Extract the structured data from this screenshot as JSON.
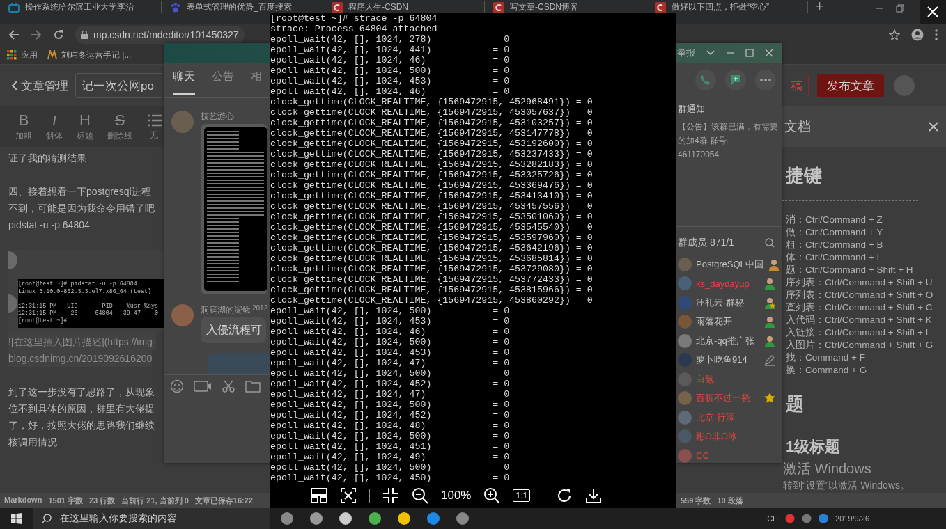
{
  "browser": {
    "tabs": [
      {
        "kind": "tv",
        "title": "操作系统哈尔滨工业大学李治"
      },
      {
        "kind": "paw",
        "title": "表单式管理的优势_百度搜索"
      },
      {
        "kind": "c-logo",
        "title": "程序人生-CSDN"
      },
      {
        "kind": "c-logo",
        "title": "写文章-CSDN博客"
      },
      {
        "kind": "c-logo",
        "title": "做好以下四点，拒做“空心”"
      }
    ],
    "new_tab": "+",
    "address": "mp.csdn.net/mdeditor/101450327",
    "bookmarks": [
      "应用",
      "刘玮冬运营手记 |..."
    ]
  },
  "editor": {
    "back_label": "文章管理",
    "title_value": "记一次公网po",
    "draft_button": "稿",
    "publish_button": "发布文章",
    "toolbar": [
      {
        "kind": "bold",
        "glyph": "B",
        "label": "加粗"
      },
      {
        "kind": "italic",
        "glyph": "I",
        "label": "斜体"
      },
      {
        "kind": "heading",
        "glyph": "H",
        "label": "标题"
      },
      {
        "kind": "strike",
        "glyph": "S",
        "label": "删除线"
      },
      {
        "kind": "list",
        "label": "无"
      }
    ],
    "content": [
      {
        "kind": "text",
        "text": "证了我的猜测结果"
      },
      {
        "kind": "blank"
      },
      {
        "kind": "text",
        "text": "四、接着想看一下postgresql进程"
      },
      {
        "kind": "text",
        "text": "不到，可能是因为我命令用错了吧"
      },
      {
        "kind": "text",
        "text": "pidstat -u -p 64804"
      },
      {
        "kind": "blank"
      },
      {
        "kind": "image",
        "lines": [
          "[root@test ~]# pidstat -u -p 64804",
          "Linux 3.10.0-862.3.3.el7.x86_64 (test)",
          "12:31:15 PM   UID       PID    %usr %sys",
          "12:31:15 PM    26     64804   39.47    0",
          "[root@test ~]#"
        ]
      },
      {
        "kind": "muted",
        "text": "![在这里插入图片描述](https://img-"
      },
      {
        "kind": "muted",
        "text": "blog.csdnimg.cn/2019092616200"
      },
      {
        "kind": "blank"
      },
      {
        "kind": "text",
        "text": "到了这一步没有了思路了，从现象"
      },
      {
        "kind": "text",
        "text": "位不到具体的原因，群里有大佬提"
      },
      {
        "kind": "text",
        "text": "了，好，按照大佬的思路我们继续"
      },
      {
        "kind": "text",
        "text": "核调用情况"
      }
    ],
    "status_left": [
      "Markdown",
      "1501 字数",
      "23 行数",
      "当前行 21, 当前列 0",
      "文章已保存16:22"
    ],
    "status_right": [
      "559 字数",
      "10 段落"
    ]
  },
  "help_panel": {
    "title": "文档",
    "heading_1": "捷键",
    "shortcuts": [
      "消：Ctrl/Command + Z",
      "做：Ctrl/Command + Y",
      "粗：Ctrl/Command + B",
      "体：Ctrl/Command + I",
      "题：Ctrl/Command + Shift + H",
      "序列表：Ctrl/Command + Shift + U",
      "序列表：Ctrl/Command + Shift + O",
      "查列表：Ctrl/Command + Shift + C",
      "入代码：Ctrl/Command + Shift + K",
      "入链接：Ctrl/Command + Shift + L",
      "入图片：Ctrl/Command + Shift + G",
      "找：Command + F",
      "换：Command + G"
    ],
    "heading_2": "题",
    "heading_3": "1级标题"
  },
  "qq": {
    "report": "举报",
    "tabs": [
      {
        "label": "聊天",
        "selected": true
      },
      {
        "label": "公告",
        "selected": false
      },
      {
        "label": "相",
        "selected": false
      }
    ],
    "messages": [
      {
        "kind": "image",
        "sender": "技艺游心"
      },
      {
        "kind": "text",
        "sender": "洞庭湖的泥鳅",
        "badge": "2012",
        "text": "入侵流程可"
      },
      {
        "kind": "cut-bubble"
      }
    ],
    "notice": {
      "title": "群通知",
      "lines": [
        "【公告】该群已满，有需要",
        "的加4群 群号:",
        "461170054"
      ]
    },
    "members_title": "群成员 871/1",
    "members": [
      {
        "name": "PostgreSQL中国",
        "color": "#c4c4c4",
        "kind": "owner"
      },
      {
        "name": "ks_daydayup",
        "color": "#e0463f",
        "kind": "admin"
      },
      {
        "name": "汪礼云-群秘",
        "color": "#c4c4c4",
        "kind": "admin-star"
      },
      {
        "name": "雨落花开",
        "color": "#c4c4c4",
        "kind": "admin"
      },
      {
        "name": "北京-qq推广张",
        "color": "#c4c4c4",
        "kind": "admin"
      },
      {
        "name": "萝卜吃鱼914",
        "color": "#c4c4c4",
        "kind": "pencil"
      },
      {
        "name": "白氪",
        "color": "#e0463f",
        "kind": "plain"
      },
      {
        "name": "百折不过一挠",
        "color": "#e0463f",
        "kind": "star"
      },
      {
        "name": "北京-行深",
        "color": "#e0463f",
        "kind": "plain"
      },
      {
        "name": "彬Θ非Θ冰",
        "color": "#e0463f",
        "kind": "plain"
      },
      {
        "name": "CC",
        "color": "#e0463f",
        "kind": "plain"
      }
    ]
  },
  "viewer": {
    "lines": [
      "[root@test ~]# strace -p 64804",
      "strace: Process 64804 attached",
      "epoll_wait(42, [], 1024, 278)           = 0",
      "epoll_wait(42, [], 1024, 441)           = 0",
      "epoll_wait(42, [], 1024, 46)            = 0",
      "epoll_wait(42, [], 1024, 500)           = 0",
      "epoll_wait(42, [], 1024, 453)           = 0",
      "epoll_wait(42, [], 1024, 46)            = 0",
      "clock_gettime(CLOCK_REALTIME, {1569472915, 452968491}) = 0",
      "clock_gettime(CLOCK_REALTIME, {1569472915, 453057637}) = 0",
      "clock_gettime(CLOCK_REALTIME, {1569472915, 453103257}) = 0",
      "clock_gettime(CLOCK_REALTIME, {1569472915, 453147778}) = 0",
      "clock_gettime(CLOCK_REALTIME, {1569472915, 453192600}) = 0",
      "clock_gettime(CLOCK_REALTIME, {1569472915, 453237433}) = 0",
      "clock_gettime(CLOCK_REALTIME, {1569472915, 453282183}) = 0",
      "clock_gettime(CLOCK_REALTIME, {1569472915, 453325726}) = 0",
      "clock_gettime(CLOCK_REALTIME, {1569472915, 453369476}) = 0",
      "clock_gettime(CLOCK_REALTIME, {1569472915, 453413410}) = 0",
      "clock_gettime(CLOCK_REALTIME, {1569472915, 453457556}) = 0",
      "clock_gettime(CLOCK_REALTIME, {1569472915, 453501060}) = 0",
      "clock_gettime(CLOCK_REALTIME, {1569472915, 453545540}) = 0",
      "clock_gettime(CLOCK_REALTIME, {1569472915, 453597960}) = 0",
      "clock_gettime(CLOCK_REALTIME, {1569472915, 453642196}) = 0",
      "clock_gettime(CLOCK_REALTIME, {1569472915, 453685814}) = 0",
      "clock_gettime(CLOCK_REALTIME, {1569472915, 453729080}) = 0",
      "clock_gettime(CLOCK_REALTIME, {1569472915, 453772433}) = 0",
      "clock_gettime(CLOCK_REALTIME, {1569472915, 453815966}) = 0",
      "clock_gettime(CLOCK_REALTIME, {1569472915, 453860292}) = 0",
      "epoll_wait(42, [], 1024, 500)           = 0",
      "epoll_wait(42, [], 1024, 453)           = 0",
      "epoll_wait(42, [], 1024, 46)            = 0",
      "epoll_wait(42, [], 1024, 500)           = 0",
      "epoll_wait(42, [], 1024, 453)           = 0",
      "epoll_wait(42, [], 1024, 47)            = 0",
      "epoll_wait(42, [], 1024, 500)           = 0",
      "epoll_wait(42, [], 1024, 452)           = 0",
      "epoll_wait(42, [], 1024, 47)            = 0",
      "epoll_wait(42, [], 1024, 500)           = 0",
      "epoll_wait(42, [], 1024, 452)           = 0",
      "epoll_wait(42, [], 1024, 48)            = 0",
      "epoll_wait(42, [], 1024, 500)           = 0",
      "epoll_wait(42, [], 1024, 451)           = 0",
      "epoll_wait(42, [], 1024, 49)            = 0",
      "epoll_wait(42, [], 1024, 500)           = 0",
      "epoll_wait(42, [], 1024, 450)           = 0"
    ],
    "zoom": "100%",
    "actual_size": "1:1"
  },
  "taskbar": {
    "search_placeholder": "在这里输入你要搜索的内容",
    "input_lang": "CH",
    "date": "2019/9/26"
  },
  "activation": {
    "title": "激活 Windows",
    "hint": "转到“设置”以激活 Windows。"
  }
}
